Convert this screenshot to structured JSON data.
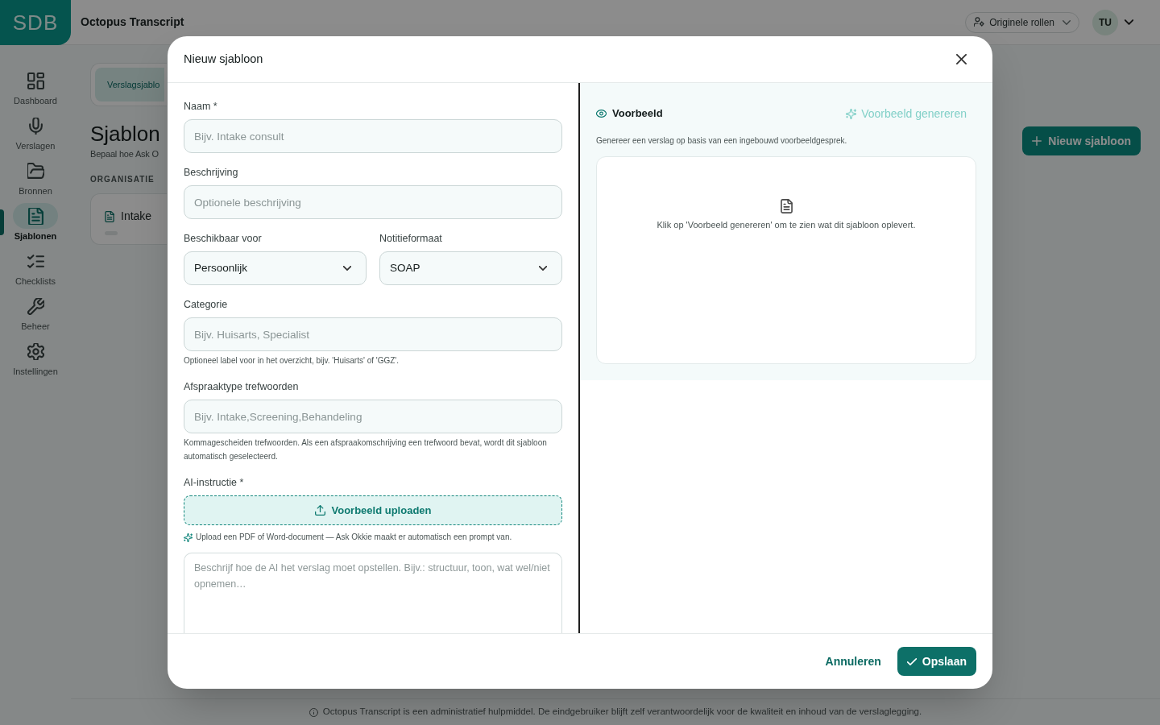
{
  "header": {
    "logo": "SDB",
    "app_title": "Octopus Transcript",
    "role_button": "Originele rollen",
    "avatar": "TU"
  },
  "sidebar": {
    "items": [
      {
        "label": "Dashboard",
        "selected": false
      },
      {
        "label": "Verslagen",
        "selected": false
      },
      {
        "label": "Bronnen",
        "selected": false
      },
      {
        "label": "Sjablonen",
        "selected": true
      },
      {
        "label": "Checklists",
        "selected": false
      },
      {
        "label": "Beheer",
        "selected": false
      },
      {
        "label": "Instellingen",
        "selected": false
      }
    ]
  },
  "page": {
    "tabs": [
      {
        "label": "Verslagsjablo",
        "selected": true
      }
    ],
    "heading": "Sjablon",
    "subtitle": "Bepaal hoe Ask O",
    "section_label": "ORGANISATIE",
    "cards": [
      {
        "title": "Intake"
      }
    ],
    "new_button": "Nieuw sjabloon"
  },
  "modal": {
    "title": "Nieuw sjabloon",
    "fields": [
      {
        "kind": "text",
        "label": "Naam *",
        "placeholder": "Bijv. Intake consult"
      },
      {
        "kind": "text",
        "label": "Beschrijving",
        "placeholder": "Optionele beschrijving"
      },
      {
        "kind": "select_pair",
        "selects": [
          {
            "label": "Beschikbaar voor",
            "value": "Persoonlijk"
          },
          {
            "label": "Notitieformaat",
            "value": "SOAP"
          }
        ]
      },
      {
        "kind": "text",
        "label": "Categorie",
        "placeholder": "Bijv. Huisarts, Specialist",
        "help": "Optioneel label voor in het overzicht, bijv. 'Huisarts' of 'GGZ'."
      },
      {
        "kind": "text",
        "label": "Afspraaktype trefwoorden",
        "placeholder": "Bijv. Intake,Screening,Behandeling",
        "help": "Kommagescheiden trefwoorden. Als een afspraakomschrijving een trefwoord bevat, wordt dit sjabloon automatisch geselecteerd."
      },
      {
        "kind": "instruction",
        "label": "AI-instructie *",
        "upload_button": "Voorbeeld uploaden",
        "hint": "Upload een PDF of Word-document — Ask Okkie maakt er automatisch een prompt van.",
        "placeholder": "Beschrijf hoe de AI het verslag moet opstellen. Bijv.: structuur, toon, wat wel/niet opnemen…"
      }
    ],
    "preview": {
      "title": "Voorbeeld",
      "generate_button": {
        "label": "Voorbeeld genereren",
        "disabled": true
      },
      "description": "Genereer een verslag op basis van een ingebouwd voorbeeldgesprek.",
      "empty_text": "Klik op 'Voorbeeld genereren' om te zien wat dit sjabloon oplevert."
    },
    "cancel_button": "Annuleren",
    "save_button": "Opslaan"
  },
  "footer": {
    "disclaimer": "Octopus Transcript is een administratief hulpmiddel. De eindgebruiker blijft zelf verantwoordelijk voor de kwaliteit en inhoud van de verslaglegging."
  }
}
